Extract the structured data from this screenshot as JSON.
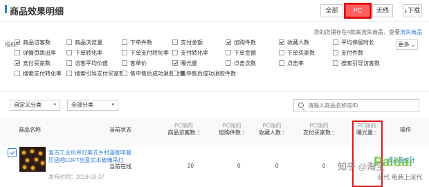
{
  "header": {
    "title": "商品效果明细",
    "tabs": [
      "全部",
      "PC",
      "无线"
    ],
    "download": "下载"
  },
  "notice": {
    "text": "您的店铺存在4款高流失商品，查看",
    "link": "流失商品"
  },
  "indicators": {
    "label": "指标：",
    "more": "更多",
    "items": [
      {
        "label": "商品访客数",
        "checked": true
      },
      {
        "label": "商品浏览量",
        "checked": false
      },
      {
        "label": "下单件数",
        "checked": false
      },
      {
        "label": "支付金额",
        "checked": false
      },
      {
        "label": "加购件数",
        "checked": true
      },
      {
        "label": "收藏人数",
        "checked": true
      },
      {
        "label": "平均停留时长",
        "checked": false
      },
      {
        "label": "详情页跳出率",
        "checked": false
      },
      {
        "label": "下单转化率",
        "checked": false
      },
      {
        "label": "下单支付转化率",
        "checked": false
      },
      {
        "label": "支付转化率",
        "checked": false
      },
      {
        "label": "下单金额",
        "checked": false
      },
      {
        "label": "下单买家数",
        "checked": false
      },
      {
        "label": "支付件数",
        "checked": false
      },
      {
        "label": "支付买家数",
        "checked": true
      },
      {
        "label": "访客平均价值",
        "checked": false
      },
      {
        "label": "客单价",
        "checked": false
      },
      {
        "label": "曝光量",
        "checked": true
      },
      {
        "label": "点击次数",
        "checked": false
      },
      {
        "label": "点击率",
        "checked": false
      },
      {
        "label": "搜索引导访客数",
        "checked": false
      },
      {
        "label": "搜索支付转化率",
        "checked": false
      },
      {
        "label": "搜索引导支付买家数",
        "checked": false
      },
      {
        "label": "售中售后成功退款金额",
        "checked": false
      },
      {
        "label": "售中售后成功退款件数",
        "checked": false
      }
    ]
  },
  "filters": {
    "category_custom": "自定义分类",
    "category_all": "全部分类",
    "search_placeholder": "请输入商品名称或ID"
  },
  "table": {
    "headers": [
      {
        "prefix": "",
        "label": "商品名称"
      },
      {
        "prefix": "",
        "label": "当前状态"
      },
      {
        "prefix": "PC端的",
        "label": "商品访客数"
      },
      {
        "prefix": "PC端的",
        "label": "加购件数"
      },
      {
        "prefix": "PC端的",
        "label": "收藏人数"
      },
      {
        "prefix": "PC端的",
        "label": "支付买家数"
      },
      {
        "prefix": "PC端的",
        "label": "曝光量"
      },
      {
        "prefix": "",
        "label": "操作"
      }
    ],
    "rows": [
      {
        "name": "复古工业风吊灯美式乡村漫咖啡餐厅酒吧LOFT创意实木玻璃吊灯",
        "date": "发布时间：2018-03-27",
        "status": "当前在线",
        "visitors": "20",
        "cart": "0",
        "fav": "0",
        "buyers": "0",
        "op": "商品温度计"
      }
    ]
  },
  "watermark": {
    "zh": "知乎 @淘宝",
    "brand": "Paidai",
    "sub": "派代 电商上派代"
  }
}
